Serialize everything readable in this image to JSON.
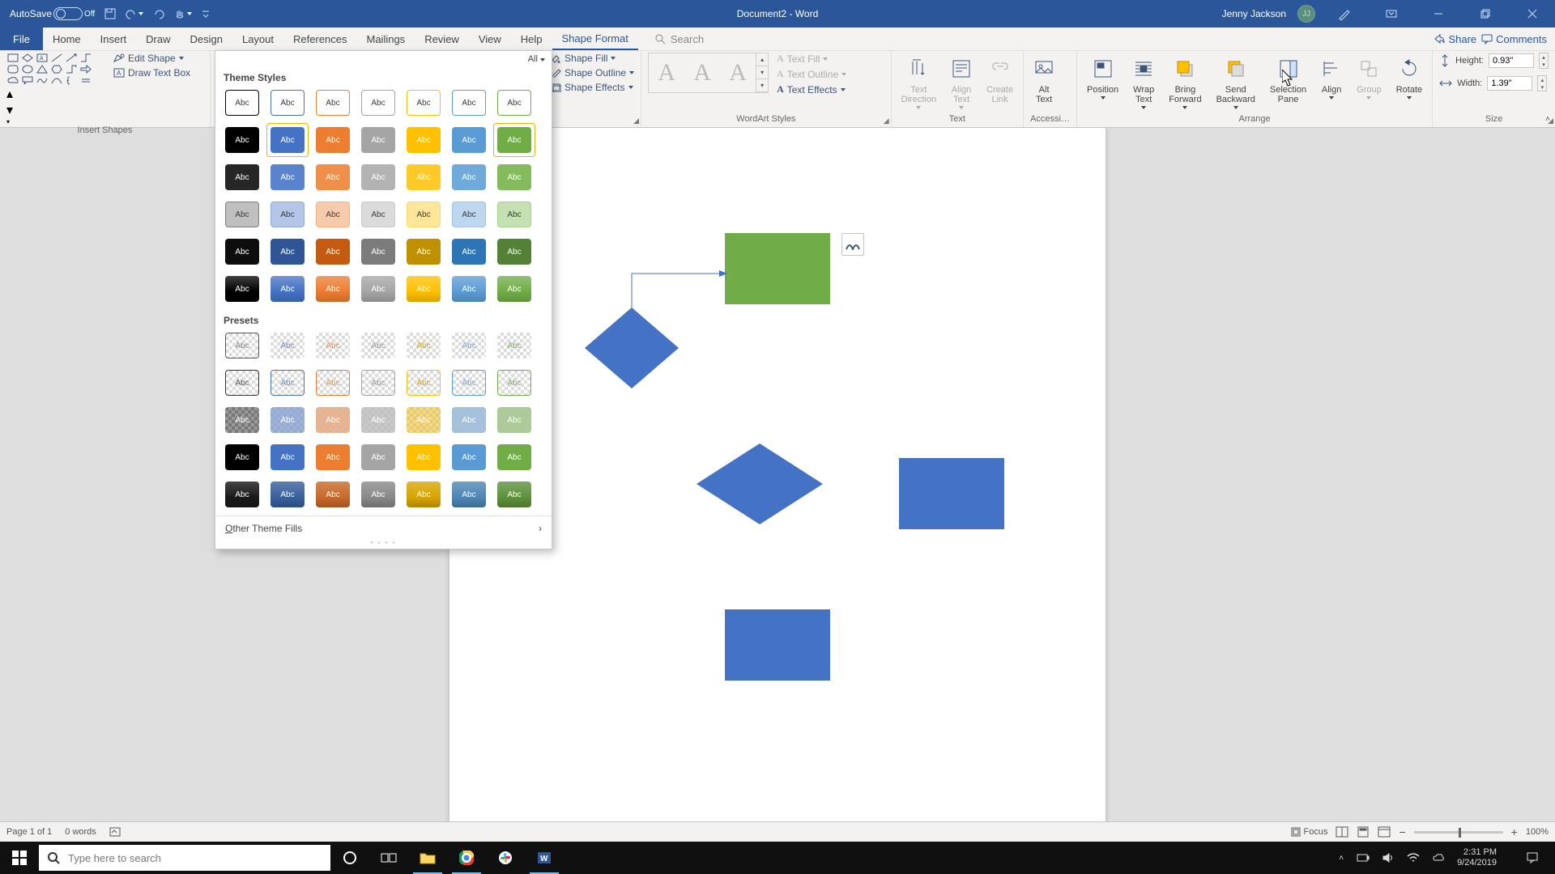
{
  "title_bar": {
    "autosave_label": "AutoSave",
    "autosave_state": "Off",
    "doc_title": "Document2 - Word",
    "user_name": "Jenny Jackson",
    "user_initials": "JJ"
  },
  "tabs": {
    "file": "File",
    "list": [
      "Home",
      "Insert",
      "Draw",
      "Design",
      "Layout",
      "References",
      "Mailings",
      "Review",
      "View",
      "Help",
      "Shape Format"
    ],
    "active": "Shape Format",
    "search_placeholder": "Search",
    "share": "Share",
    "comments": "Comments"
  },
  "ribbon": {
    "insert_shapes": {
      "title": "Insert Shapes",
      "edit_shape": "Edit Shape",
      "draw_text_box": "Draw Text Box"
    },
    "shape_styles_hdr": {
      "all_label": "All"
    },
    "shape_style_cmds": {
      "fill": "Shape Fill",
      "outline": "Shape Outline",
      "effects": "Shape Effects"
    },
    "wordart": {
      "title": "WordArt Styles",
      "text_fill": "Text Fill",
      "text_outline": "Text Outline",
      "text_effects": "Text Effects"
    },
    "text_group": {
      "title": "Text",
      "text_direction": "Text\nDirection",
      "align_text": "Align\nText",
      "create_link": "Create\nLink"
    },
    "access_group": {
      "title": "Accessi…",
      "alt_text": "Alt\nText"
    },
    "arrange_group": {
      "title": "Arrange",
      "position": "Position",
      "wrap_text": "Wrap\nText",
      "bring_forward": "Bring\nForward",
      "send_backward": "Send\nBackward",
      "selection_pane": "Selection\nPane",
      "align": "Align",
      "group": "Group",
      "rotate": "Rotate"
    },
    "size_group": {
      "title": "Size",
      "height_label": "Height:",
      "height_value": "0.93\"",
      "width_label": "Width:",
      "width_value": "1.39\""
    }
  },
  "styles_panel": {
    "all_label": "All",
    "theme_title": "Theme Styles",
    "presets_title": "Presets",
    "swatch_text": "Abc",
    "other_fills": "Other Theme Fills",
    "theme_colors": [
      {
        "bg": "#ffffff",
        "fg": "#3a3a3a",
        "bd": "#000000"
      },
      {
        "bg": "#ffffff",
        "fg": "#3a3a3a",
        "bd": "#4472c4"
      },
      {
        "bg": "#ffffff",
        "fg": "#3a3a3a",
        "bd": "#ed7d31"
      },
      {
        "bg": "#ffffff",
        "fg": "#3a3a3a",
        "bd": "#a5a5a5"
      },
      {
        "bg": "#ffffff",
        "fg": "#3a3a3a",
        "bd": "#ffc000"
      },
      {
        "bg": "#ffffff",
        "fg": "#3a3a3a",
        "bd": "#5b9bd5"
      },
      {
        "bg": "#ffffff",
        "fg": "#3a3a3a",
        "bd": "#70ad47"
      }
    ],
    "theme_rows": [
      [
        {
          "bg": "#000000",
          "fg": "#ffffff"
        },
        {
          "bg": "#4472c4",
          "fg": "#ffffff",
          "sel": true
        },
        {
          "bg": "#ed7d31",
          "fg": "#ffffff"
        },
        {
          "bg": "#a5a5a5",
          "fg": "#ffffff"
        },
        {
          "bg": "#ffc000",
          "fg": "#ffffff"
        },
        {
          "bg": "#5b9bd5",
          "fg": "#ffffff"
        },
        {
          "bg": "#70ad47",
          "fg": "#ffffff",
          "sel": true
        }
      ],
      [
        {
          "bg": "#262626",
          "fg": "#ffffff"
        },
        {
          "bg": "#5983cc",
          "fg": "#ffffff"
        },
        {
          "bg": "#f08f4a",
          "fg": "#ffffff"
        },
        {
          "bg": "#b3b3b3",
          "fg": "#ffffff"
        },
        {
          "bg": "#ffca28",
          "fg": "#ffffff"
        },
        {
          "bg": "#70aadb",
          "fg": "#ffffff"
        },
        {
          "bg": "#84bb5c",
          "fg": "#ffffff"
        }
      ],
      [
        {
          "bg": "#bfbfbf",
          "fg": "#3a3a3a",
          "bd": "#7f7f7f"
        },
        {
          "bg": "#b4c6e7",
          "fg": "#3a3a3a",
          "bd": "#8faadc"
        },
        {
          "bg": "#f7caac",
          "fg": "#3a3a3a",
          "bd": "#f4b183"
        },
        {
          "bg": "#dbdbdb",
          "fg": "#3a3a3a",
          "bd": "#c9c9c9"
        },
        {
          "bg": "#ffe699",
          "fg": "#3a3a3a",
          "bd": "#ffd966"
        },
        {
          "bg": "#bdd7ee",
          "fg": "#3a3a3a",
          "bd": "#9dc3e6"
        },
        {
          "bg": "#c5e0b3",
          "fg": "#3a3a3a",
          "bd": "#a8d08d"
        }
      ],
      [
        {
          "bg": "#0d0d0d",
          "fg": "#ffffff"
        },
        {
          "bg": "#2f5597",
          "fg": "#ffffff"
        },
        {
          "bg": "#c55a11",
          "fg": "#ffffff"
        },
        {
          "bg": "#7b7b7b",
          "fg": "#ffffff"
        },
        {
          "bg": "#bf9000",
          "fg": "#ffffff"
        },
        {
          "bg": "#2e75b6",
          "fg": "#ffffff"
        },
        {
          "bg": "#538135",
          "fg": "#ffffff"
        }
      ],
      [
        {
          "bg": "#000000",
          "fg": "#ffffff",
          "grad": true
        },
        {
          "bg": "#4472c4",
          "fg": "#ffffff",
          "grad": true
        },
        {
          "bg": "#ed7d31",
          "fg": "#ffffff",
          "grad": true
        },
        {
          "bg": "#a5a5a5",
          "fg": "#ffffff",
          "grad": true
        },
        {
          "bg": "#ffc000",
          "fg": "#ffffff",
          "grad": true
        },
        {
          "bg": "#5b9bd5",
          "fg": "#ffffff",
          "grad": true
        },
        {
          "bg": "#70ad47",
          "fg": "#ffffff",
          "grad": true
        }
      ]
    ],
    "preset_rows": [
      [
        {
          "bg": "#ffffff",
          "fg": "#888",
          "hatch": true,
          "bd": "#555"
        },
        {
          "bg": "#ffffff",
          "fg": "#6a8bc8",
          "hatch": true
        },
        {
          "bg": "#ffffff",
          "fg": "#e2935a",
          "hatch": true
        },
        {
          "bg": "#ffffff",
          "fg": "#999",
          "hatch": true
        },
        {
          "bg": "#ffffff",
          "fg": "#d8a500",
          "hatch": true
        },
        {
          "bg": "#ffffff",
          "fg": "#7aa8d2",
          "hatch": true
        },
        {
          "bg": "#ffffff",
          "fg": "#85ab69",
          "hatch": true
        }
      ],
      [
        {
          "bg": "#ffffff",
          "fg": "#555",
          "hatch": true,
          "bd": "#333"
        },
        {
          "bg": "#ffffff",
          "fg": "#6a8bc8",
          "hatch": true,
          "bd": "#4472c4"
        },
        {
          "bg": "#ffffff",
          "fg": "#e2935a",
          "hatch": true,
          "bd": "#ed7d31"
        },
        {
          "bg": "#ffffff",
          "fg": "#999",
          "hatch": true,
          "bd": "#a5a5a5"
        },
        {
          "bg": "#ffffff",
          "fg": "#d8a500",
          "hatch": true,
          "bd": "#ffc000"
        },
        {
          "bg": "#ffffff",
          "fg": "#7aa8d2",
          "hatch": true,
          "bd": "#5b9bd5"
        },
        {
          "bg": "#ffffff",
          "fg": "#85ab69",
          "hatch": true,
          "bd": "#70ad47"
        }
      ],
      [
        {
          "bg": "#777",
          "fg": "#fff",
          "hatch": true
        },
        {
          "bg": "#8faadc",
          "fg": "#fff",
          "hatch": true
        },
        {
          "bg": "#f4b183",
          "fg": "#fff",
          "hatch": true
        },
        {
          "bg": "#c9c9c9",
          "fg": "#fff",
          "hatch": true
        },
        {
          "bg": "#ffd966",
          "fg": "#fff",
          "hatch": true
        },
        {
          "bg": "#9dc3e6",
          "fg": "#fff",
          "hatch": true
        },
        {
          "bg": "#a8d08d",
          "fg": "#fff",
          "hatch": true
        }
      ],
      [
        {
          "bg": "#000000",
          "fg": "#ffffff"
        },
        {
          "bg": "#4472c4",
          "fg": "#ffffff"
        },
        {
          "bg": "#ed7d31",
          "fg": "#ffffff"
        },
        {
          "bg": "#a5a5a5",
          "fg": "#ffffff"
        },
        {
          "bg": "#ffc000",
          "fg": "#ffffff"
        },
        {
          "bg": "#5b9bd5",
          "fg": "#ffffff"
        },
        {
          "bg": "#70ad47",
          "fg": "#ffffff"
        }
      ],
      [
        {
          "bg": "#1a1a1a",
          "fg": "#ffffff",
          "grad": true
        },
        {
          "bg": "#38619e",
          "fg": "#ffffff",
          "grad": true
        },
        {
          "bg": "#c96a2a",
          "fg": "#ffffff",
          "grad": true
        },
        {
          "bg": "#8a8a8a",
          "fg": "#ffffff",
          "grad": true
        },
        {
          "bg": "#d8a500",
          "fg": "#ffffff",
          "grad": true
        },
        {
          "bg": "#4e87b6",
          "fg": "#ffffff",
          "grad": true
        },
        {
          "bg": "#5e923c",
          "fg": "#ffffff",
          "grad": true
        }
      ]
    ]
  },
  "status": {
    "page": "Page 1 of 1",
    "words": "0 words",
    "focus": "Focus",
    "zoom": "100%"
  },
  "taskbar": {
    "search_placeholder": "Type here to search",
    "time": "2:31 PM",
    "date": "9/24/2019"
  }
}
